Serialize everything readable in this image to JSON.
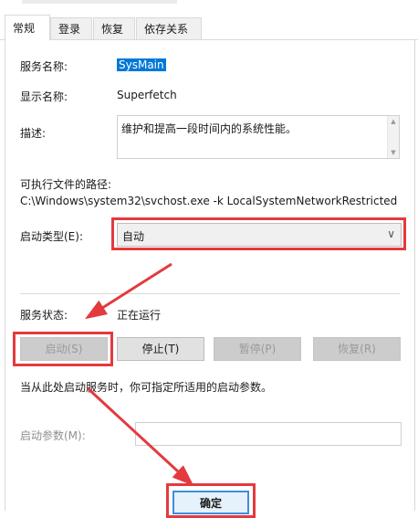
{
  "tabs": [
    {
      "label": "常规"
    },
    {
      "label": "登录"
    },
    {
      "label": "恢复"
    },
    {
      "label": "依存关系"
    }
  ],
  "general": {
    "service_name_label": "服务名称:",
    "service_name_value": "SysMain",
    "display_name_label": "显示名称:",
    "display_name_value": "Superfetch",
    "description_label": "描述:",
    "description_value": "维护和提高一段时间内的系统性能。",
    "path_label": "可执行文件的路径:",
    "path_value": "C:\\Windows\\system32\\svchost.exe -k LocalSystemNetworkRestricted",
    "startup_type_label": "启动类型(E):",
    "startup_type_value": "自动",
    "service_status_label": "服务状态:",
    "service_status_value": "正在运行",
    "buttons": {
      "start": "启动(S)",
      "stop": "停止(T)",
      "pause": "暂停(P)",
      "resume": "恢复(R)"
    },
    "hint_text": "当从此处启动服务时，你可指定所适用的启动参数。",
    "start_params_label": "启动参数(M):",
    "start_params_value": ""
  },
  "footer": {
    "ok_label": "确定"
  },
  "colors": {
    "annotation_red": "#e33a3f",
    "selection_blue": "#0078d7",
    "ok_border": "#3c8fd8"
  },
  "icons": {
    "combo_arrow": "chevron-down-icon",
    "scroll_up": "scroll-up-arrow-icon",
    "scroll_down": "scroll-down-arrow-icon"
  }
}
